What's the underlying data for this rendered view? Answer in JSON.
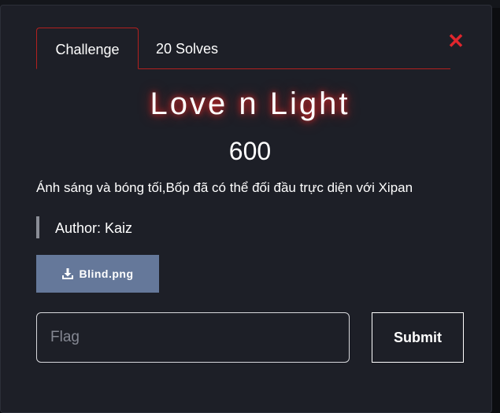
{
  "tabs": [
    {
      "label": "Challenge",
      "active": true
    },
    {
      "label": "20 Solves",
      "active": false
    }
  ],
  "close": {
    "icon": "close-x-icon",
    "glyph": "✕"
  },
  "challenge": {
    "title": "Love n Light",
    "points": "600",
    "description": "Ánh sáng và bóng tối,Bốp đã có thể đối đầu trực diện với Xipan",
    "author": "Author: Kaiz"
  },
  "file": {
    "name": "Blind.png",
    "icon": "download-icon"
  },
  "flag_form": {
    "placeholder": "Flag",
    "value": "",
    "submit_label": "Submit"
  },
  "colors": {
    "accent": "#b3201f",
    "close": "#e0262d",
    "file_button": "#65789a",
    "modal_bg": "#1d1f27"
  }
}
